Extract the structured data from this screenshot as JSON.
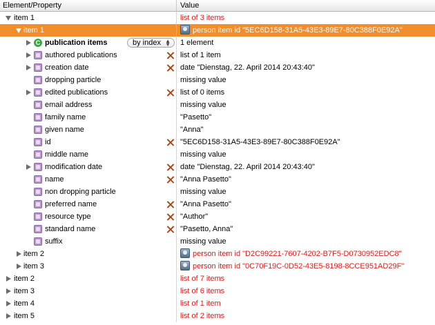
{
  "header": {
    "col_property": "Element/Property",
    "col_value": "Value"
  },
  "popup": {
    "label": "by index"
  },
  "rows": [
    {
      "label": "item 1",
      "value": "list of 3 items"
    },
    {
      "label": "item 1",
      "value": "person item id \"5EC6D158-31A5-43E3-89E7-80C388F0E92A\""
    },
    {
      "label": "publication items",
      "value": "1 element"
    },
    {
      "label": "authored publications",
      "value": "list of 1 item"
    },
    {
      "label": "creation date",
      "value": "date \"Dienstag, 22. April 2014 20:43:40\""
    },
    {
      "label": "dropping particle",
      "value": "missing value"
    },
    {
      "label": "edited publications",
      "value": "list of 0 items"
    },
    {
      "label": "email address",
      "value": "missing value"
    },
    {
      "label": "family name",
      "value": "\"Pasetto\""
    },
    {
      "label": "given name",
      "value": "\"Anna\""
    },
    {
      "label": "id",
      "value": "\"5EC6D158-31A5-43E3-89E7-80C388F0E92A\""
    },
    {
      "label": "middle name",
      "value": "missing value"
    },
    {
      "label": "modification date",
      "value": "date \"Dienstag, 22. April 2014 20:43:40\""
    },
    {
      "label": "name",
      "value": "\"Anna Pasetto\""
    },
    {
      "label": "non dropping particle",
      "value": "missing value"
    },
    {
      "label": "preferred name",
      "value": "\"Anna Pasetto\""
    },
    {
      "label": "resource type",
      "value": "\"Author\""
    },
    {
      "label": "standard name",
      "value": "\"Pasetto, Anna\""
    },
    {
      "label": "suffix",
      "value": "missing value"
    },
    {
      "label": "item 2",
      "value": "person item id \"D2C99221-7607-4202-B7F5-D0730952EDC8\""
    },
    {
      "label": "item 3",
      "value": "person item id \"0C70F19C-0D52-43E5-8198-8CCE951AD29F\""
    },
    {
      "label": "item 2",
      "value": "list of 7 items"
    },
    {
      "label": "item 3",
      "value": "list of 6 items"
    },
    {
      "label": "item 4",
      "value": "list of 1 item"
    },
    {
      "label": "item 5",
      "value": "list of 2 items"
    }
  ],
  "colors": {
    "selection": "#f28d2c",
    "list_text": "#e01b1b",
    "property_icon": "#b896c9",
    "class_icon": "#39a83f"
  },
  "icons": {
    "property": "property-icon",
    "class": "class-icon",
    "readonly": "readonly-x-icon",
    "person_item": "person-item-icon"
  }
}
